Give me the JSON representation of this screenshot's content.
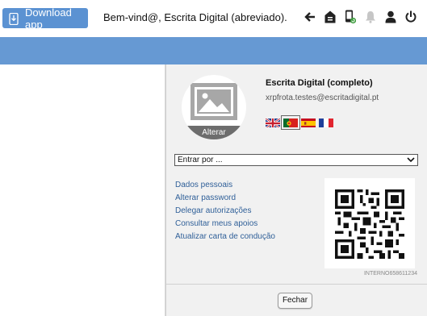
{
  "header": {
    "download_label": "Download app",
    "welcome_text": "Bem-vind@, Escrita Digital (abreviado).",
    "icons": [
      "arrow-left-icon",
      "home-icon",
      "mobile-refresh-icon",
      "bell-icon",
      "user-icon",
      "power-icon"
    ]
  },
  "profile": {
    "avatar_change_label": "Alterar",
    "name": "Escrita Digital (completo)",
    "email": "xrpfrota.testes@escritadigital.pt",
    "languages": [
      "flag-uk-icon",
      "flag-portugal-icon",
      "flag-spain-icon",
      "flag-france-icon"
    ],
    "selected_language": "flag-portugal-icon",
    "enter_select_value": "Entrar por ...",
    "links": [
      "Dados pessoais",
      "Alterar password",
      "Delegar autorizações",
      "Consultar meus apoios",
      "Atualizar carta de condução"
    ],
    "qr_code_label": "INTERNO658611234",
    "close_label": "Fechar"
  },
  "colors": {
    "header_band": "#6699d3",
    "download_button": "#5b92d2",
    "link": "#2f5f98",
    "panel": "#f1f1f1"
  }
}
